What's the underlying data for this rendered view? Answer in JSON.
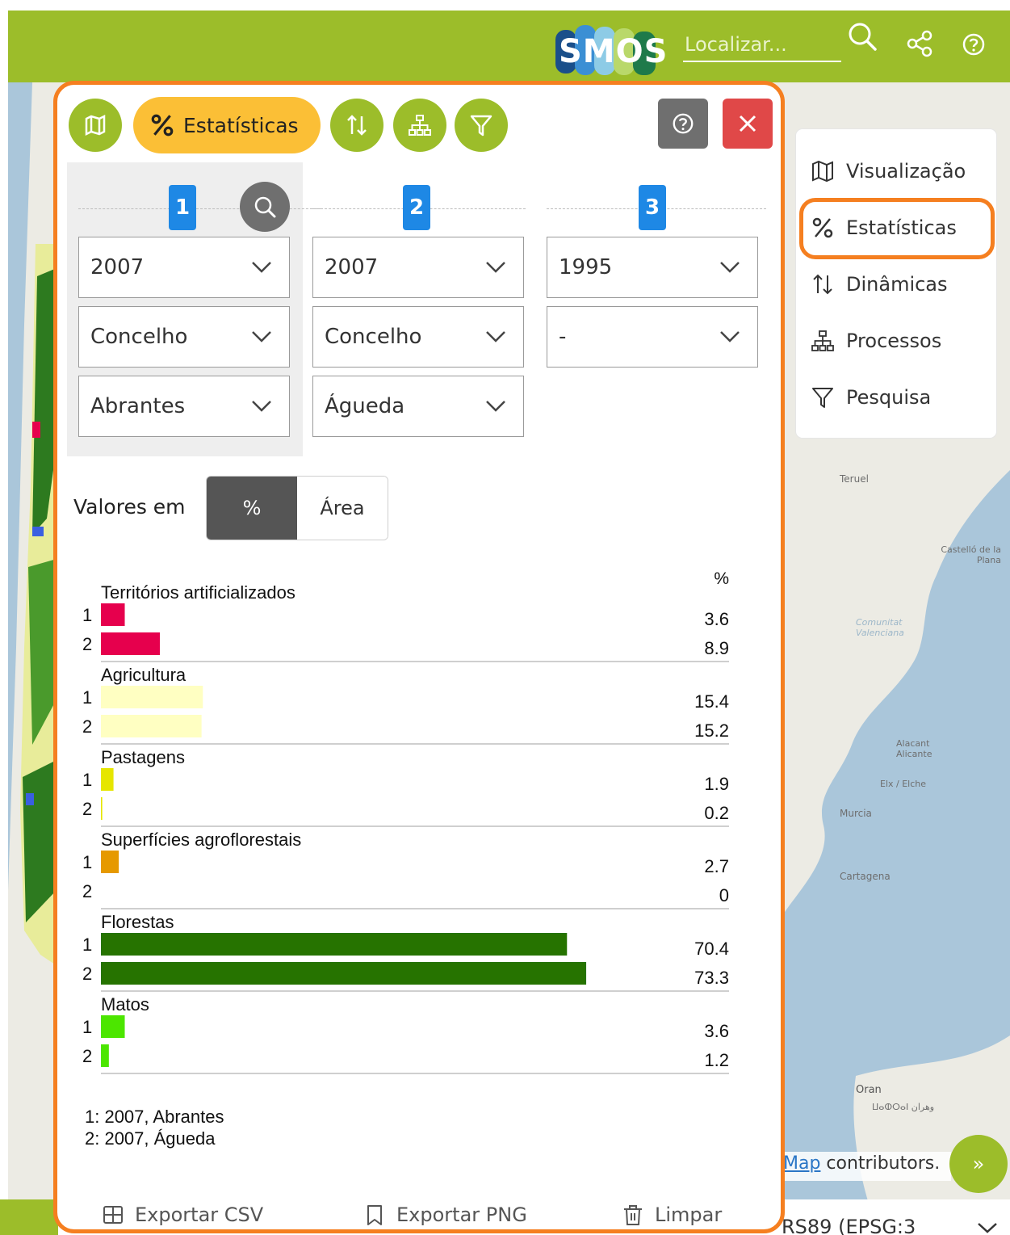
{
  "header": {
    "logo_text": "SMOS",
    "search_placeholder": "Localizar..."
  },
  "nav": {
    "items": [
      {
        "label": "Visualização",
        "icon": "map-icon"
      },
      {
        "label": "Estatísticas",
        "icon": "percent-icon"
      },
      {
        "label": "Dinâmicas",
        "icon": "sort-arrows-icon"
      },
      {
        "label": "Processos",
        "icon": "hierarchy-icon"
      },
      {
        "label": "Pesquisa",
        "icon": "filter-icon"
      }
    ]
  },
  "panel": {
    "active_tab_label": "Estatísticas",
    "columns": [
      {
        "number": "1",
        "year": "2007",
        "level": "Concelho",
        "unit": "Abrantes"
      },
      {
        "number": "2",
        "year": "2007",
        "level": "Concelho",
        "unit": "Águeda"
      },
      {
        "number": "3",
        "year": "1995",
        "level": "-"
      }
    ],
    "values_label": "Valores em",
    "toggle": {
      "percent": "%",
      "area": "Área"
    },
    "legend_lines": [
      "1: 2007, Abrantes",
      "2: 2007, Águeda"
    ],
    "buttons": {
      "export_csv": "Exportar CSV",
      "export_png": "Exportar PNG",
      "clear": "Limpar"
    }
  },
  "chart_data": {
    "type": "bar",
    "orientation": "horizontal",
    "unit_label": "%",
    "categories": [
      "Territórios artificializados",
      "Agricultura",
      "Pastagens",
      "Superfícies agroflorestais",
      "Florestas",
      "Matos"
    ],
    "colors": [
      "#e6004d",
      "#ffffc2",
      "#e6e600",
      "#e69900",
      "#267300",
      "#4ce600"
    ],
    "series": [
      {
        "name": "1",
        "values": [
          3.6,
          15.4,
          1.9,
          2.7,
          70.4,
          3.6
        ]
      },
      {
        "name": "2",
        "values": [
          8.9,
          15.2,
          0.2,
          0,
          73.3,
          1.2
        ]
      }
    ],
    "value_labels": [
      [
        "3.6",
        "8.9"
      ],
      [
        "15.4",
        "15.2"
      ],
      [
        "1.9",
        "0.2"
      ],
      [
        "2.7",
        "0"
      ],
      [
        "70.4",
        "73.3"
      ],
      [
        "3.6",
        "1.2"
      ]
    ]
  },
  "map": {
    "attribution_link": "Map",
    "attribution_text": " contributors.",
    "crs_label": "RS89 (EPSG:3",
    "place_labels": [
      "Teruel",
      "Castelló de la Plana",
      "Comunitat Valenciana",
      "Alacant Alicante",
      "Elx / Elche",
      "Murcia",
      "Cartagena",
      "Oran",
      "ⵡⴰⵀⵔⴰⵏ وهران"
    ]
  },
  "expand_symbol": "»"
}
